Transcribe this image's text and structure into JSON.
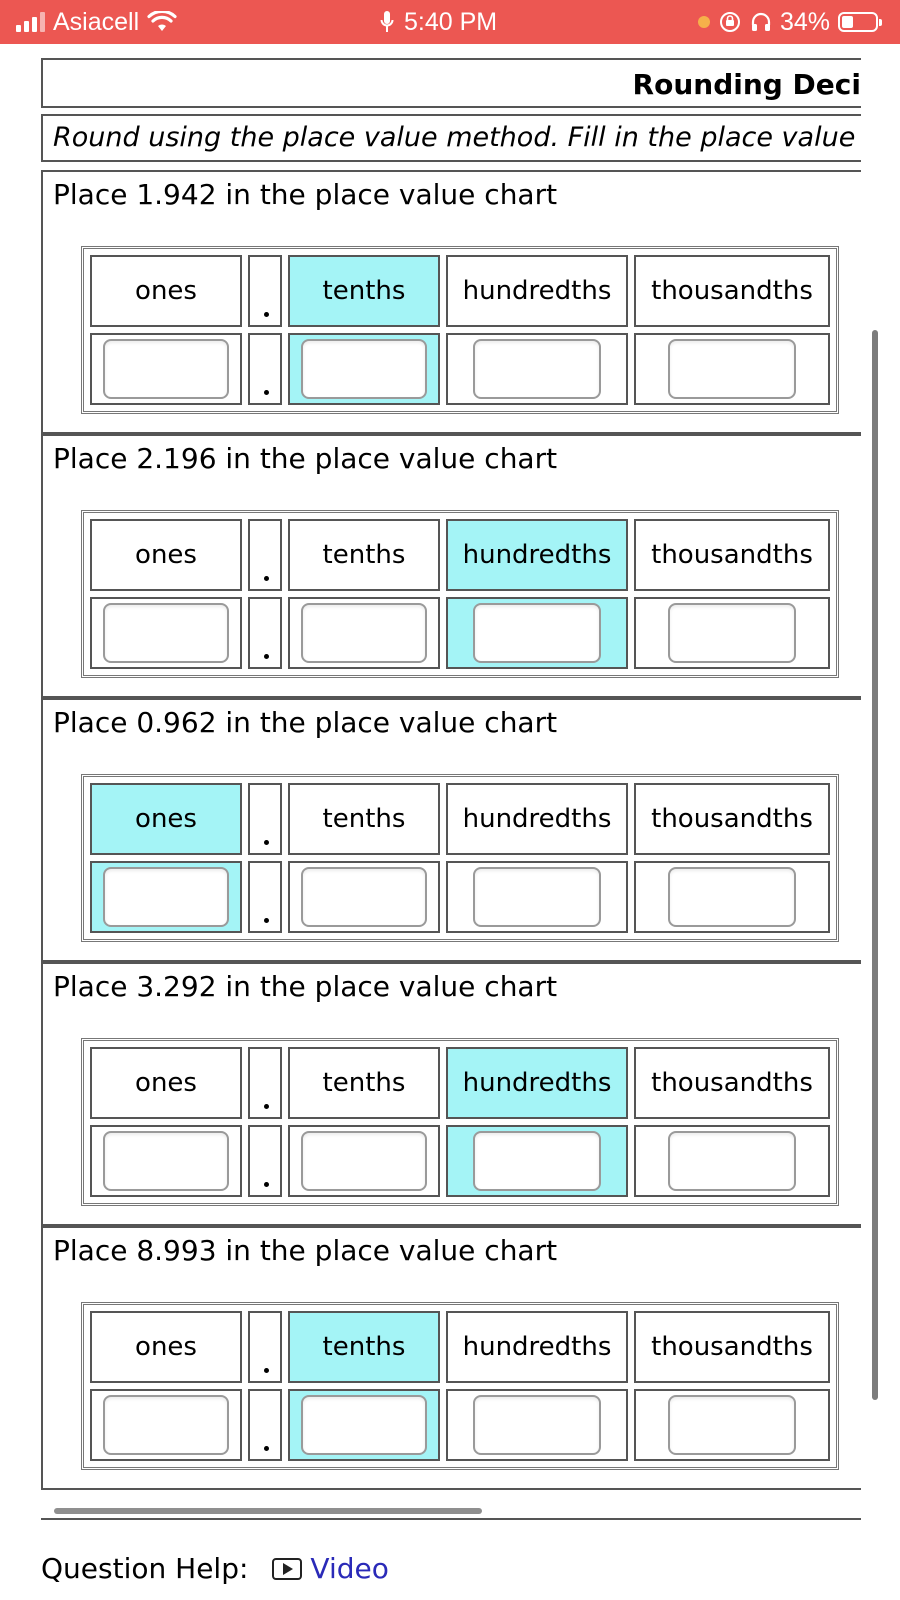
{
  "status_bar": {
    "carrier": "Asiacell",
    "time": "5:40 PM",
    "battery": "34%",
    "background_color": "#ec5752"
  },
  "header": {
    "title": "Rounding Deci",
    "instructions": "Round using the place value method. Fill in the place value"
  },
  "column_labels": {
    "ones": "ones",
    "tenths": "tenths",
    "hundredths": "hundredths",
    "thousandths": "thousandths"
  },
  "highlight_color": "#a4f4f6",
  "problems": [
    {
      "prompt": "Place 1.942 in the place value chart",
      "highlighted_place": "tenths"
    },
    {
      "prompt": "Place 2.196 in the place value chart",
      "highlighted_place": "hundredths"
    },
    {
      "prompt": "Place 0.962 in the place value chart",
      "highlighted_place": "ones"
    },
    {
      "prompt": "Place 3.292 in the place value chart",
      "highlighted_place": "hundredths"
    },
    {
      "prompt": "Place 8.993 in the place value chart",
      "highlighted_place": "tenths"
    }
  ],
  "help": {
    "label": "Question Help:",
    "video_link": "Video",
    "video_icon": "play-icon",
    "link_color": "#2a2ab8"
  }
}
